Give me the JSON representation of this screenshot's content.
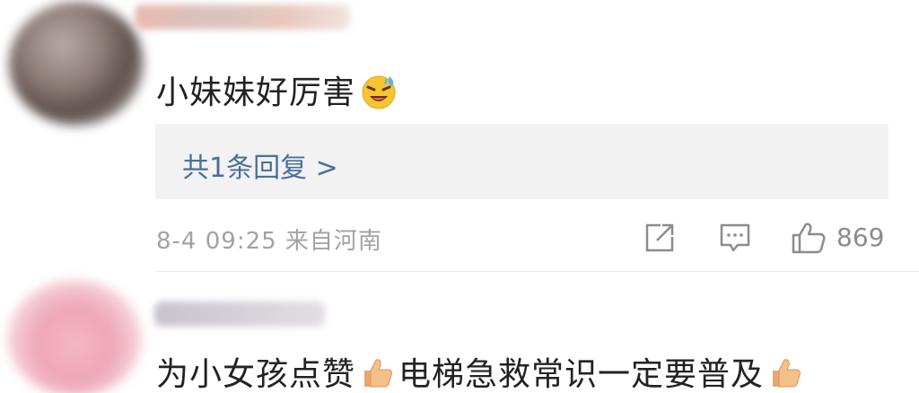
{
  "comments": [
    {
      "text": "小妹妹好厉害",
      "emoji": "laughing-crying-face-icon",
      "reply_link": "共1条回复 >",
      "meta": "8-4 09:25  来自河南",
      "like_count": "869"
    },
    {
      "text_part1": "为小女孩点赞",
      "emoji1": "thumbs-up-icon",
      "text_part2": "电梯急救常识一定要普及",
      "emoji2": "thumbs-up-icon"
    }
  ],
  "colors": {
    "reply_link": "#4a6f9c",
    "meta": "#a2a2a2",
    "reply_box_bg": "#f2f2f2"
  }
}
